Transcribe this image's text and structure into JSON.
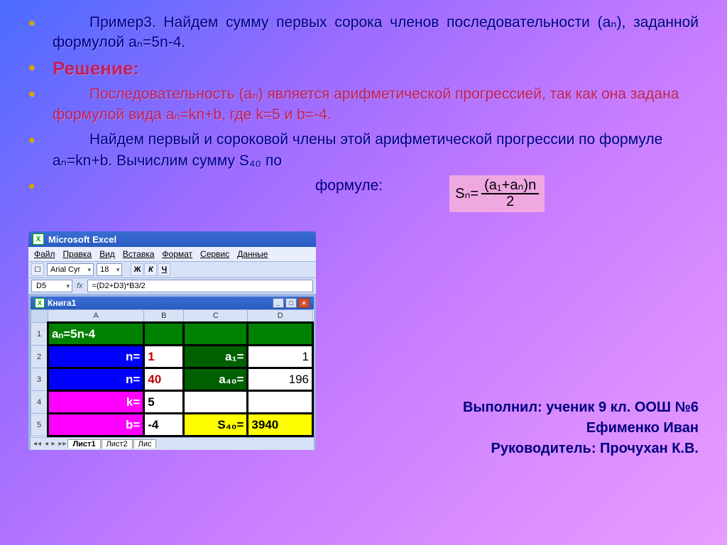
{
  "bullets": {
    "example": "Пример3. Найдем сумму первых сорока членов последовательности (aₙ), заданной формулой aₙ=5n-4.",
    "solution_heading": "Решение:",
    "seq": "Последовательность (aₙ) является арифметической прогрессией, так как она задана формулой вида aₙ=kn+b, где k=5 и b=-4.",
    "find": "Найдем первый и сороковой члены этой арифметической прогрессии по формуле aₙ=kn+b. Вычислим сумму S₄₀ по",
    "formula_word": "формуле:"
  },
  "formula": {
    "lhs": "Sₙ=",
    "num": "(a₁+aₙ)n",
    "den": "2"
  },
  "excel": {
    "app_title": "Microsoft Excel",
    "menus": [
      "Файл",
      "Правка",
      "Вид",
      "Вставка",
      "Формат",
      "Сервис",
      "Данные"
    ],
    "font_name": "Arial Cyr",
    "font_size": "18",
    "b": "Ж",
    "i": "К",
    "u": "Ч",
    "namebox": "D5",
    "fx": "fx",
    "formula_bar": "=(D2+D3)*B3/2",
    "book_title": "Книга1",
    "cols": [
      "A",
      "B",
      "C",
      "D"
    ],
    "rows": [
      {
        "A": "aₙ=5n-4",
        "B": "",
        "C": "",
        "D": ""
      },
      {
        "A": "n=",
        "B": "1",
        "C": "a₁=",
        "D": "1"
      },
      {
        "A": "n=",
        "B": "40",
        "C": "a₄₀=",
        "D": "196"
      },
      {
        "A": "k=",
        "B": "5",
        "C": "",
        "D": ""
      },
      {
        "A": "b=",
        "B": "-4",
        "C": "S₄₀=",
        "D": "3940"
      }
    ],
    "sheet_tabs": [
      "Лист1",
      "Лист2",
      "Лис"
    ]
  },
  "credits": {
    "line1": "Выполнил: ученик 9 кл. ООШ №6",
    "line2": "Ефименко Иван",
    "line3": "Руководитель: Прочухан К.В."
  }
}
